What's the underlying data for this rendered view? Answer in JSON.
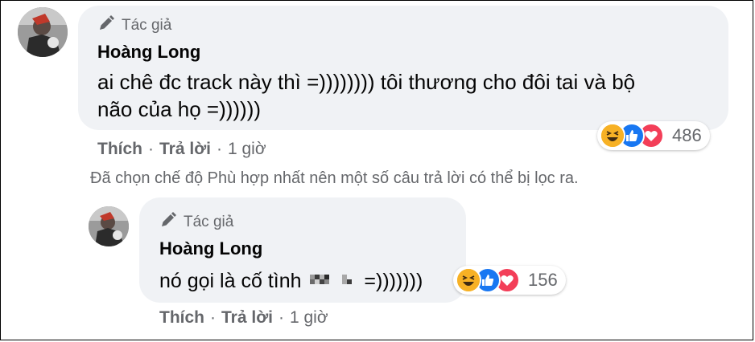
{
  "comment1": {
    "author_badge": "Tác giả",
    "name": "Hoàng Long",
    "text_line1": "ai chê đc track này thì =)))))))) tôi thương cho đôi tai và bộ",
    "text_line2": "não của họ =))))))",
    "actions": {
      "like": "Thích",
      "reply": "Trả lời",
      "time": "1 giờ"
    },
    "reaction_count": "486"
  },
  "filter_notice": "Đã chọn chế độ Phù hợp nhất nên một số câu trả lời có thể bị lọc ra.",
  "reply1": {
    "author_badge": "Tác giả",
    "name": "Hoàng Long",
    "text_before": "nó gọi là cố tình",
    "text_after": "=)))))))",
    "actions": {
      "like": "Thích",
      "reply": "Trả lời",
      "time": "1 giờ"
    },
    "reaction_count": "156"
  },
  "icons": [
    "author-pen-icon",
    "haha-reaction-icon",
    "like-reaction-icon",
    "love-reaction-icon"
  ],
  "colors": {
    "bubble": "#f0f2f5",
    "secondary_text": "#65676b",
    "like_blue": "#1877f2",
    "love_red": "#f33e58",
    "haha_yellow": "#f7b125"
  }
}
